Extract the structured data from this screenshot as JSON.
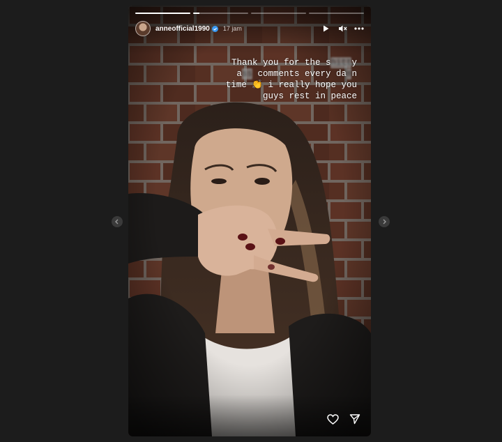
{
  "story": {
    "username": "anneofficial1990",
    "timestamp": "17 jam",
    "progress": {
      "segments": 4,
      "active_index": 1,
      "active_fill_fraction": 0.12
    },
    "caption": {
      "line1_prefix": "Thank you for the s",
      "line1_blur": "hitt",
      "line1_suffix": "y",
      "line2_prefix": "a",
      "line2_blur": "ss",
      "line2_middle": " comments every da",
      "line2_blur2": "m",
      "line2_suffix": "n",
      "line3_prefix": "time ",
      "line3_emoji": "👏",
      "line3_suffix": " i really hope you",
      "line4": "guys rest in peace"
    }
  },
  "icons": {
    "play": "play-icon",
    "mute": "speaker-muted-icon",
    "more": "more-icon",
    "like": "heart-icon",
    "share": "send-icon",
    "verified": "verified-badge-icon",
    "prev": "chevron-left-icon",
    "next": "chevron-right-icon"
  },
  "colors": {
    "page_bg": "#1c1c1c",
    "verified": "#3897f0",
    "brick": "#6b3a2a",
    "mortar": "#8a8178"
  }
}
